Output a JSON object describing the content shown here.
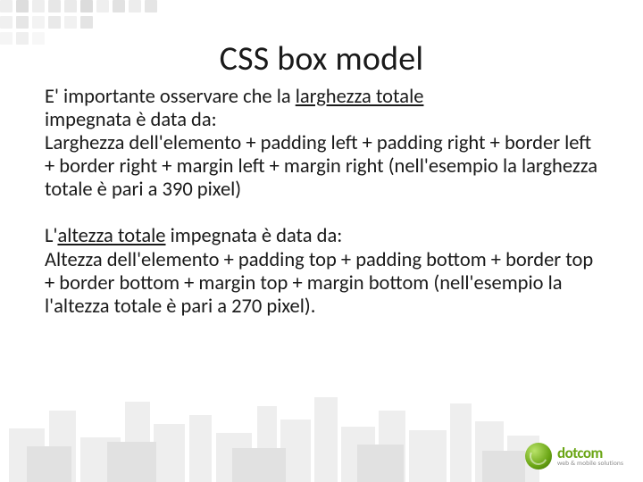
{
  "title": "CSS box model",
  "para1": {
    "lead": "E' importante osservare che la ",
    "underlined": "larghezza totale",
    "afterLead": "impegnata è data da:",
    "line2": "Larghezza dell'elemento + padding left + padding right + border left + border right + margin left + margin right (nell'esempio la larghezza totale è pari a 390 pixel)"
  },
  "para2": {
    "leadPrefix": "L'",
    "underlined": "altezza totale",
    "leadSuffix": " impegnata è data da:",
    "line2": "Altezza dell'elemento + padding top + padding bottom + border top + border bottom + margin top + margin bottom (nell'esempio la l'altezza totale è pari a 270 pixel)."
  },
  "logo": {
    "main": "dotcom",
    "sub": "web & mobile solutions"
  }
}
